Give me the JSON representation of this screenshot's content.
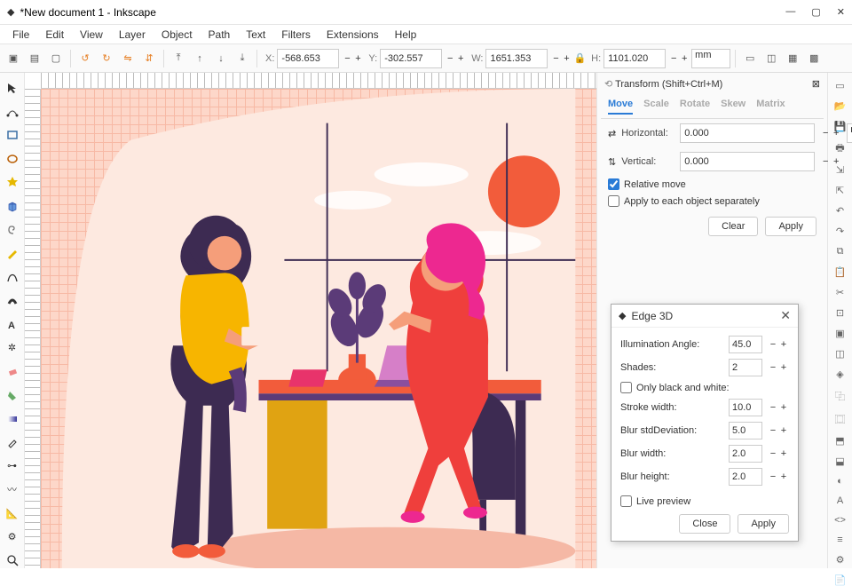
{
  "window": {
    "title": "*New document 1 - Inkscape"
  },
  "menu": [
    "File",
    "Edit",
    "View",
    "Layer",
    "Object",
    "Path",
    "Text",
    "Filters",
    "Extensions",
    "Help"
  ],
  "coords": {
    "xLabel": "X:",
    "x": "-568.653",
    "yLabel": "Y:",
    "y": "-302.557",
    "wLabel": "W:",
    "w": "1651.353",
    "hLabel": "H:",
    "h": "1101.020",
    "unit": "mm"
  },
  "transform": {
    "title": "Transform (Shift+Ctrl+M)",
    "tabs": [
      "Move",
      "Scale",
      "Rotate",
      "Skew",
      "Matrix"
    ],
    "hLabel": "Horizontal:",
    "h": "0.000",
    "vLabel": "Vertical:",
    "v": "0.000",
    "unit": "mm",
    "relative": "Relative move",
    "applyEach": "Apply to each object separately",
    "clear": "Clear",
    "apply": "Apply"
  },
  "dialog": {
    "title": "Edge 3D",
    "rows": [
      {
        "label": "Illumination Angle:",
        "val": "45.0"
      },
      {
        "label": "Shades:",
        "val": "2"
      }
    ],
    "onlyBW": "Only black and white:",
    "rows2": [
      {
        "label": "Stroke width:",
        "val": "10.0"
      },
      {
        "label": "Blur stdDeviation:",
        "val": "5.0"
      },
      {
        "label": "Blur width:",
        "val": "2.0"
      },
      {
        "label": "Blur height:",
        "val": "2.0"
      }
    ],
    "live": "Live preview",
    "close": "Close",
    "apply": "Apply"
  }
}
